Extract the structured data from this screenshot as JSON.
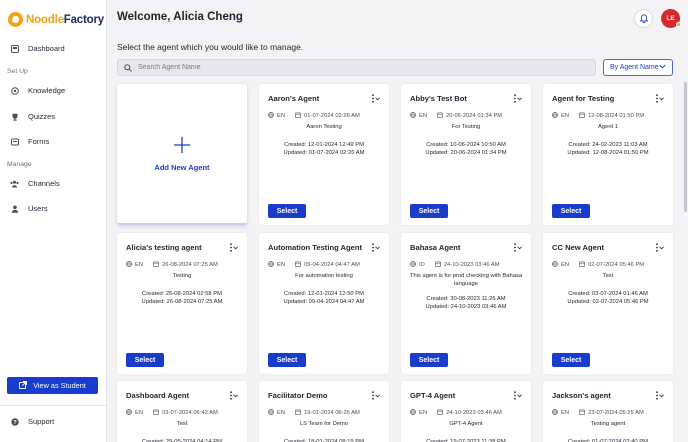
{
  "app": {
    "logo_a": "Noodle",
    "logo_b": "Factory"
  },
  "sidebar": {
    "dashboard": "Dashboard",
    "setup_section": "Set Up",
    "knowledge": "Knowledge",
    "quizzes": "Quizzes",
    "forms": "Forms",
    "manage_section": "Manage",
    "channels": "Channels",
    "users": "Users",
    "view_student": "View as Student",
    "support": "Support"
  },
  "header": {
    "welcome": "Welcome, Alicia Cheng",
    "avatar_initials": "LE"
  },
  "main": {
    "subtitle": "Select the agent which you would like to manage.",
    "search_placeholder": "Search Agent Name",
    "sort_label": "By Agent Name",
    "add_label": "Add New Agent",
    "select_label": "Select"
  },
  "colors": {
    "accent": "#1a3ccc",
    "logo": "#f2a21b",
    "avatar": "#d62a2a"
  },
  "agents": [
    {
      "name": "Aaron's Agent",
      "lang": "EN",
      "date": "01-07-2024 02:26 AM",
      "desc": "Aaron Testing",
      "created": "Created: 12-01-2024 12:49 PM",
      "updated": "Updated: 01-07-2024 02:26 AM"
    },
    {
      "name": "Abby's Test Bot",
      "lang": "EN",
      "date": "20-06-2024 01:34 PM",
      "desc": "For Testing",
      "created": "Created: 10-06-2024 10:50 AM",
      "updated": "Updated: 20-06-2024 01:34 PM"
    },
    {
      "name": "Agent for Testing",
      "lang": "EN",
      "date": "12-08-2024 01:50 PM",
      "desc": "Agent 1",
      "created": "Created: 24-02-2023 11:03 AM",
      "updated": "Updated: 12-08-2024 01:50 PM"
    },
    {
      "name": "Alicia's testing agent",
      "lang": "EN",
      "date": "26-08-2024 07:25 AM",
      "desc": "Testing",
      "created": "Created: 26-08-2024 02:58 PM",
      "updated": "Updated: 26-08-2024 07:25 AM"
    },
    {
      "name": "Automation Testing Agent",
      "lang": "EN",
      "date": "09-04-2024 04:47 AM",
      "desc": "For automation testing",
      "created": "Created: 12-01-2024 12:50 PM",
      "updated": "Updated: 09-04-2024 04:47 AM"
    },
    {
      "name": "Bahasa Agent",
      "lang": "ID",
      "date": "24-10-2023 03:46 AM",
      "desc": "This agent is for prod checking with Bahasa language",
      "created": "Created: 30-08-2023 11:26 AM",
      "updated": "Updated: 24-10-2023 03:46 AM"
    },
    {
      "name": "CC New Agent",
      "lang": "EN",
      "date": "02-07-2024 05:46 PM",
      "desc": "Test",
      "created": "Created: 03-07-2024 01:46 AM",
      "updated": "Updated: 02-07-2024 05:46 PM"
    },
    {
      "name": "Dashboard Agent",
      "lang": "EN",
      "date": "03-07-2024 06:42 AM",
      "desc": "Test",
      "created": "Created: 29-05-2024 04:14 PM",
      "updated": ""
    },
    {
      "name": "Facilitator Demo",
      "lang": "EN",
      "date": "19-01-2024 06:26 AM",
      "desc": "LS Team for Demo",
      "created": "Created: 18-01-2024 08:19 PM",
      "updated": ""
    },
    {
      "name": "GPT-4 Agent",
      "lang": "EN",
      "date": "24-10-2023 03:46 AM",
      "desc": "GPT-4 Agent",
      "created": "Created: 19-07-2023 11:38 PM",
      "updated": ""
    },
    {
      "name": "Jackson's agent",
      "lang": "EN",
      "date": "23-07-2024 05:25 AM",
      "desc": "Testing agent",
      "created": "Created: 01-07-2024 02:40 PM",
      "updated": ""
    }
  ]
}
